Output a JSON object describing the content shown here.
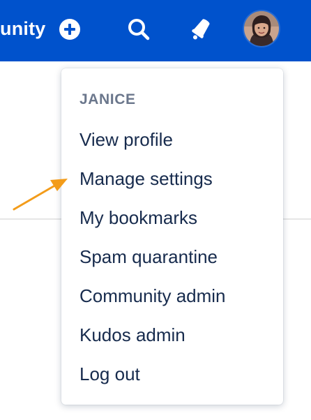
{
  "header": {
    "brand_partial": "unity",
    "background_color": "#0052cc",
    "icons": {
      "create": "plus-circle-icon",
      "search": "search-icon",
      "notifications": "megaphone-icon",
      "profile": "avatar"
    }
  },
  "menu": {
    "username": "JANICE",
    "items": [
      {
        "label": "View profile"
      },
      {
        "label": "Manage settings"
      },
      {
        "label": "My bookmarks"
      },
      {
        "label": "Spam quarantine"
      },
      {
        "label": "Community admin"
      },
      {
        "label": "Kudos admin"
      },
      {
        "label": "Log out"
      }
    ]
  },
  "annotation": {
    "arrow_color": "#f39c1a",
    "points_to": "Manage settings"
  }
}
